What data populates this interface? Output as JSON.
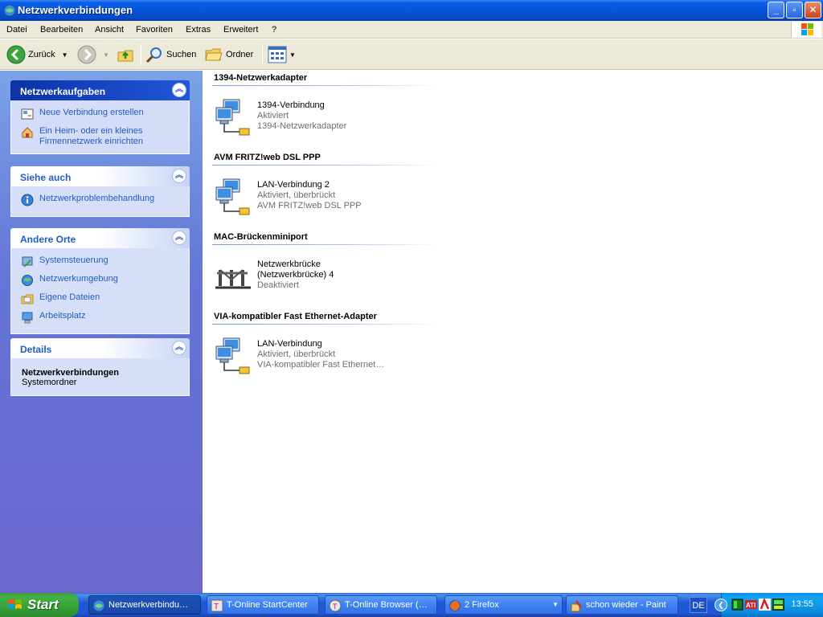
{
  "window": {
    "title": "Netzwerkverbindungen"
  },
  "menu": [
    "Datei",
    "Bearbeiten",
    "Ansicht",
    "Favoriten",
    "Extras",
    "Erweitert",
    "?"
  ],
  "toolbar": {
    "back_label": "Zurück",
    "search_label": "Suchen",
    "folders_label": "Ordner"
  },
  "left_pane": {
    "network_tasks": {
      "title": "Netzwerkaufgaben",
      "items": [
        {
          "label": "Neue Verbindung erstellen",
          "icon": "new-connection-icon"
        },
        {
          "label": "Ein Heim- oder ein kleines Firmennetzwerk einrichten",
          "icon": "home-network-icon"
        }
      ]
    },
    "see_also": {
      "title": "Siehe auch",
      "items": [
        {
          "label": "Netzwerkproblembehandlung",
          "icon": "info-icon"
        }
      ]
    },
    "other_places": {
      "title": "Andere Orte",
      "items": [
        {
          "label": "Systemsteuerung",
          "icon": "control-panel-icon"
        },
        {
          "label": "Netzwerkumgebung",
          "icon": "network-places-icon"
        },
        {
          "label": "Eigene Dateien",
          "icon": "my-documents-icon"
        },
        {
          "label": "Arbeitsplatz",
          "icon": "my-computer-icon"
        }
      ]
    },
    "details": {
      "title": "Details",
      "name": "Netzwerkverbindungen",
      "type": "Systemordner"
    }
  },
  "groups": [
    {
      "header": "1394-Netzwerkadapter",
      "connection": {
        "name": "1394-Verbindung",
        "status": "Aktiviert",
        "device": "1394-Netzwerkadapter",
        "icon": "network-connection-icon"
      }
    },
    {
      "header": "AVM FRITZ!web DSL PPP",
      "connection": {
        "name": "LAN-Verbindung 2",
        "status": "Aktiviert, überbrückt",
        "device": "AVM FRITZ!web DSL PPP",
        "icon": "network-connection-icon"
      }
    },
    {
      "header": "MAC-Brückenminiport",
      "connection": {
        "name": "Netzwerkbrücke",
        "status": "(Netzwerkbrücke) 4",
        "device": "Deaktiviert",
        "icon": "network-bridge-icon"
      }
    },
    {
      "header": "VIA-kompatibler Fast Ethernet-Adapter",
      "connection": {
        "name": "LAN-Verbindung",
        "status": "Aktiviert, überbrückt",
        "device": "VIA-kompatibler Fast Ethernet…",
        "icon": "network-connection-icon"
      }
    }
  ],
  "taskbar": {
    "start_label": "Start",
    "buttons": [
      {
        "label": "Netzwerkverbindu…",
        "active": true
      },
      {
        "label": "T-Online StartCenter",
        "active": false
      },
      {
        "label": "T-Online Browser (…",
        "active": false
      },
      {
        "label": "2 Firefox",
        "active": false
      },
      {
        "label": "schon wieder - Paint",
        "active": false
      }
    ],
    "language": "DE",
    "clock": "13:55"
  },
  "colors": {
    "title_bar": "#0755d8",
    "task_pane": "#6375d6",
    "link": "#215dc6",
    "start_green": "#37a337",
    "tray_blue": "#0c8bea"
  }
}
